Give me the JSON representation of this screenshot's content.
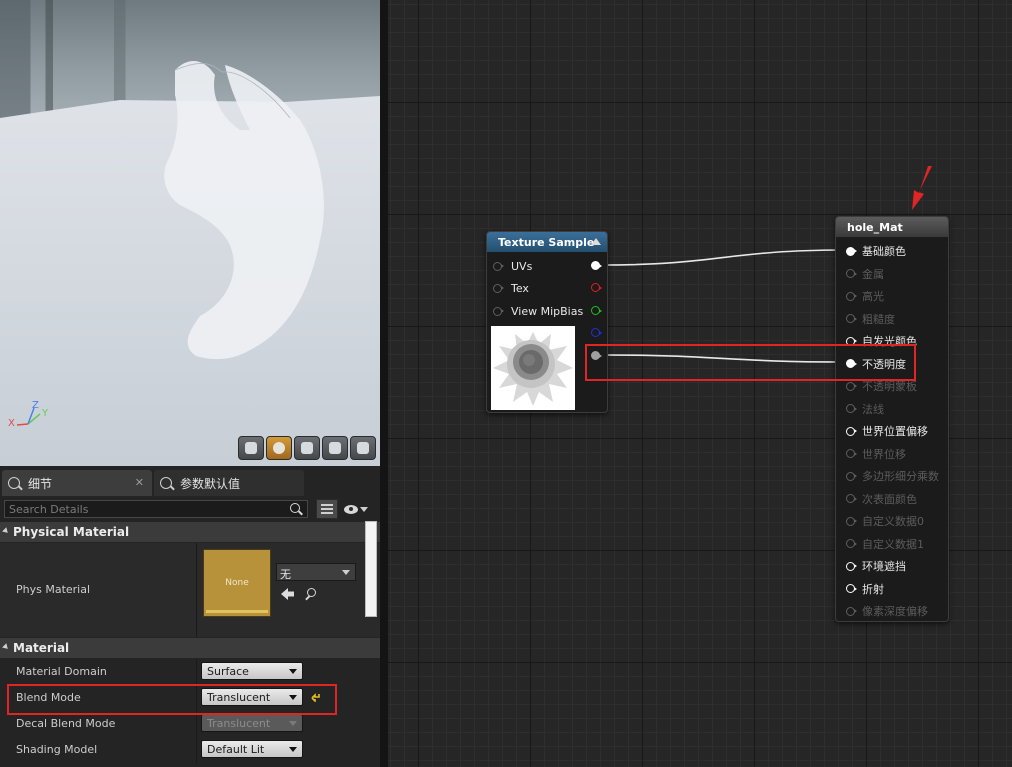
{
  "axis": {
    "x": "X",
    "y": "Y",
    "z": "Z"
  },
  "viewport_toolbar": {
    "items": [
      "perspective-view-icon",
      "realtime-sphere-icon",
      "plane-preview-icon",
      "cube-preview-icon",
      "cylinder-preview-icon"
    ]
  },
  "details": {
    "tabs": [
      {
        "label": "细节",
        "icon": "details-icon"
      },
      {
        "label": "参数默认值",
        "icon": "parameter-defaults-icon"
      }
    ],
    "search": {
      "placeholder": "Search Details"
    },
    "physical_material": {
      "header": "Physical Material",
      "label": "Phys Material",
      "thumb_label": "None",
      "combo_value": "无"
    },
    "material": {
      "header": "Material",
      "rows": [
        {
          "label": "Material Domain",
          "value": "Surface"
        },
        {
          "label": "Blend Mode",
          "value": "Translucent"
        },
        {
          "label": "Decal Blend Mode",
          "value": "Translucent"
        },
        {
          "label": "Shading Model",
          "value": "Default Lit"
        }
      ]
    }
  },
  "graph": {
    "texture_node": {
      "title": "Texture Sample",
      "inputs": [
        "UVs",
        "Tex",
        "View MipBias"
      ],
      "output_colors": [
        "#ffffff",
        "#e02020",
        "#20c020",
        "#2030e0",
        "#a0a0a0"
      ]
    },
    "material_node": {
      "title": "hole_Mat",
      "pins": [
        {
          "label": "基础颜色",
          "state": "connected"
        },
        {
          "label": "金属",
          "state": "disabled"
        },
        {
          "label": "高光",
          "state": "disabled"
        },
        {
          "label": "粗糙度",
          "state": "disabled"
        },
        {
          "label": "自发光颜色",
          "state": "enabled"
        },
        {
          "label": "不透明度",
          "state": "connected"
        },
        {
          "label": "不透明蒙板",
          "state": "disabled"
        },
        {
          "label": "法线",
          "state": "disabled"
        },
        {
          "label": "世界位置偏移",
          "state": "enabled"
        },
        {
          "label": "世界位移",
          "state": "disabled"
        },
        {
          "label": "多边形细分乘数",
          "state": "disabled"
        },
        {
          "label": "次表面颜色",
          "state": "disabled"
        },
        {
          "label": "自定义数据0",
          "state": "disabled"
        },
        {
          "label": "自定义数据1",
          "state": "disabled"
        },
        {
          "label": "环境遮挡",
          "state": "enabled"
        },
        {
          "label": "折射",
          "state": "enabled"
        },
        {
          "label": "像素深度偏移",
          "state": "disabled"
        }
      ]
    }
  },
  "annotation_color": "#e02525"
}
